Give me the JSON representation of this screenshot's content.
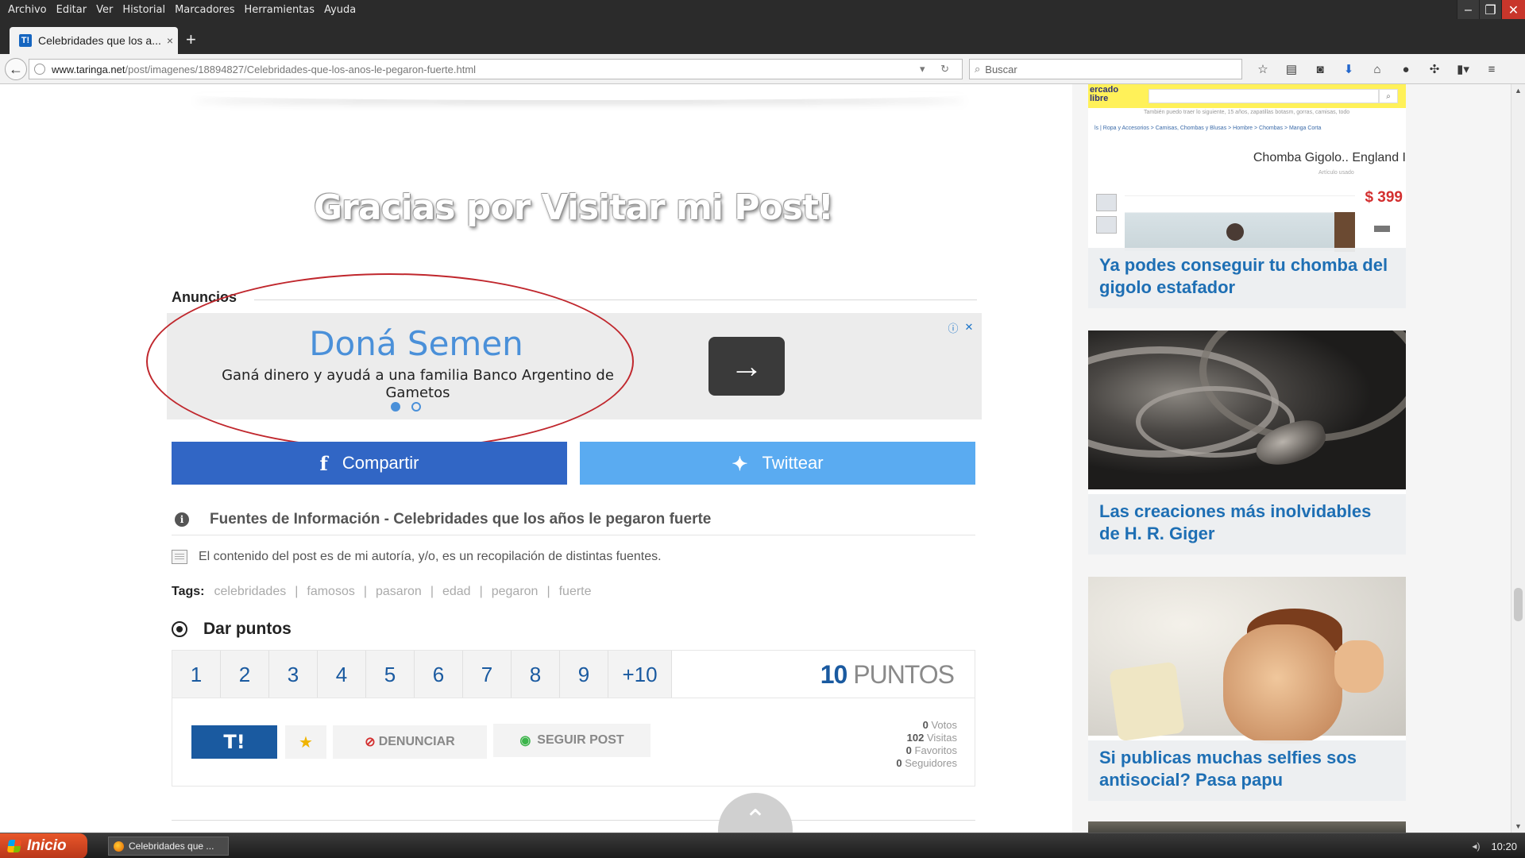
{
  "browser": {
    "menu": [
      "Archivo",
      "Editar",
      "Ver",
      "Historial",
      "Marcadores",
      "Herramientas",
      "Ayuda"
    ],
    "tab": {
      "favicon": "T!",
      "title": "Celebridades que los a...",
      "close": "×"
    },
    "new_tab": "+",
    "url": {
      "host": "www.taringa.net",
      "path": "/post/imagenes/18894827/Celebridades-que-los-anos-le-pegaron-fuerte.html"
    },
    "search_placeholder": "Buscar",
    "toolbar_icons": [
      "star-icon",
      "reading-list-icon",
      "pocket-icon",
      "download-icon",
      "home-icon",
      "chat-icon",
      "extension-icon",
      "clipboard-icon",
      "menu-icon"
    ]
  },
  "post": {
    "thanks_banner": "Gracias por Visitar mi Post!",
    "ads_label": "Anuncios",
    "ad": {
      "title": "Doná Semen",
      "description_line1": "Ganá dinero y ayudá a una familia Banco Argentino de",
      "description_line2": "Gametos",
      "active_slide": 1,
      "slide_count": 2,
      "arrow": "→"
    },
    "share": {
      "facebook": "Compartir",
      "twitter": "Twittear",
      "facebook_icon": "f",
      "twitter_icon": "🐦"
    },
    "sources_title": "Fuentes de Información - Celebridades que los años le pegaron fuerte",
    "content_note": "El contenido del post es de mi autoría, y/o, es un recopilación de distintas fuentes.",
    "tags_label": "Tags:",
    "tags": [
      "celebridades",
      "famosos",
      "pasaron",
      "edad",
      "pegaron",
      "fuerte"
    ],
    "points_title": "Dar puntos",
    "point_options": [
      "1",
      "2",
      "3",
      "4",
      "5",
      "6",
      "7",
      "8",
      "9",
      "+10"
    ],
    "points_total_number": "10",
    "points_total_label": "PUNTOS",
    "buttons": {
      "taringa": "T!",
      "report": "DENUNCIAR",
      "follow": "SEGUIR POST"
    },
    "stats": [
      {
        "value": "0",
        "label": "Votos"
      },
      {
        "value": "102",
        "label": "Visitas"
      },
      {
        "value": "0",
        "label": "Favoritos"
      },
      {
        "value": "0",
        "label": "Seguidores"
      }
    ]
  },
  "sidebar": {
    "ml_logo": [
      "ercado",
      "libre"
    ],
    "ml_small": "También puedo traer lo siguiente, 15 años, zapatillas botasm, gorras, camisas, todo",
    "ml_breadcrumb": "ls | Ropa y Accesorios > Camisas, Chombas y Blusas > Hombre > Chombas > Manga Corta",
    "ml_product": "Chomba Gigolo.. England I",
    "ml_seller": "Artículo usado",
    "ml_price": "$ 399",
    "cards": [
      {
        "title": "Ya podes conseguir tu chomba del gigolo estafador"
      },
      {
        "title": "Las creaciones más inolvidables de H. R. Giger"
      },
      {
        "title": "Si publicas muchas selfies sos antisocial? Pasa papu"
      }
    ]
  },
  "taskbar": {
    "start": "Inicio",
    "task": "Celebridades que ...",
    "time": "10:20"
  }
}
